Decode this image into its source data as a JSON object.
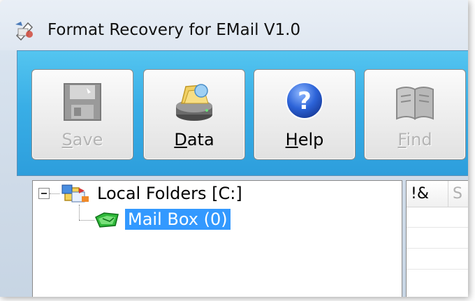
{
  "window": {
    "title": "Format Recovery for EMail V1.0"
  },
  "toolbar": {
    "buttons": [
      {
        "label_hotkey": "S",
        "label_rest": "ave",
        "icon": "save-icon",
        "enabled": false
      },
      {
        "label_hotkey": "D",
        "label_rest": "ata",
        "icon": "data-icon",
        "enabled": true
      },
      {
        "label_hotkey": "H",
        "label_rest": "elp",
        "icon": "help-icon",
        "enabled": true
      },
      {
        "label_hotkey": "F",
        "label_rest": "ind",
        "icon": "find-icon",
        "enabled": false
      }
    ]
  },
  "tree": {
    "root": {
      "label": "Local Folders [C:]",
      "icon": "local-folders-icon",
      "expanded": true
    },
    "children": [
      {
        "label": "Mail Box (0)",
        "icon": "mailbox-icon",
        "selected": true
      }
    ]
  },
  "list": {
    "columns": [
      {
        "label": "!&"
      },
      {
        "label": "S"
      }
    ]
  },
  "colors": {
    "toolbar_bg": "#39aee6",
    "selection": "#3399ff"
  }
}
